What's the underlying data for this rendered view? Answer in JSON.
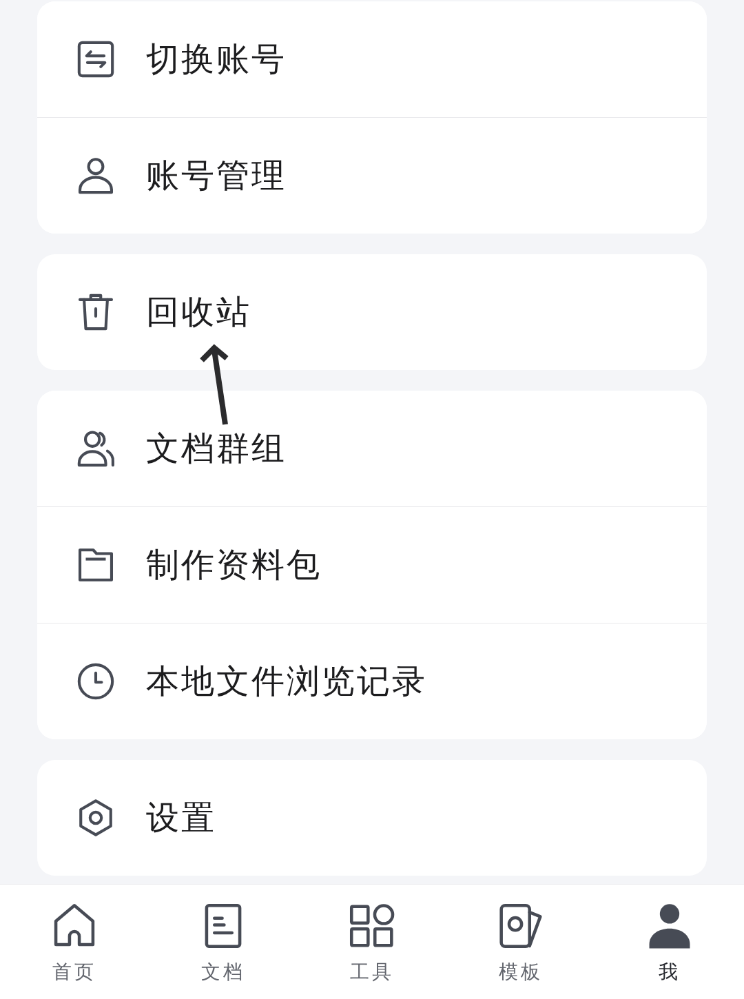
{
  "menu_groups": [
    {
      "items": [
        {
          "kind": "switch-account",
          "label": "切换账号"
        },
        {
          "kind": "account",
          "label": "账号管理"
        }
      ]
    },
    {
      "items": [
        {
          "kind": "recycle-bin",
          "label": "回收站"
        }
      ]
    },
    {
      "items": [
        {
          "kind": "group",
          "label": "文档群组"
        },
        {
          "kind": "package",
          "label": "制作资料包"
        },
        {
          "kind": "history",
          "label": "本地文件浏览记录"
        }
      ]
    },
    {
      "items": [
        {
          "kind": "settings",
          "label": "设置"
        }
      ]
    }
  ],
  "annotation": {
    "kind": "arrow"
  },
  "bottom_nav": [
    {
      "kind": "home",
      "label": "首页",
      "selected": false
    },
    {
      "kind": "documents",
      "label": "文档",
      "selected": false
    },
    {
      "kind": "tools",
      "label": "工具",
      "selected": false
    },
    {
      "kind": "templates",
      "label": "模板",
      "selected": false
    },
    {
      "kind": "me",
      "label": "我",
      "selected": true
    }
  ]
}
